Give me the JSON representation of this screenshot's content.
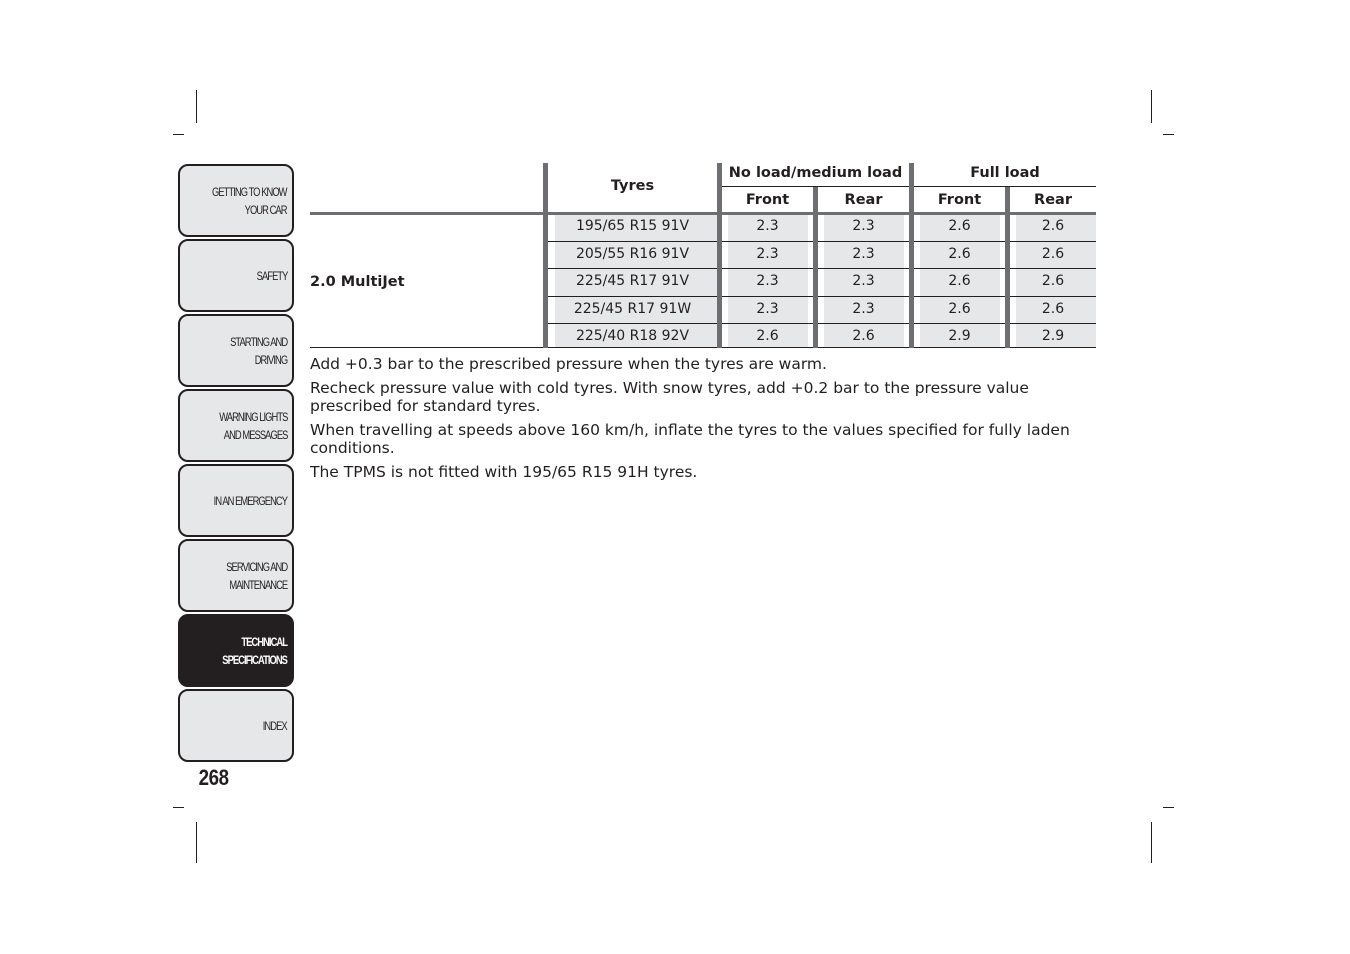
{
  "sidebar": {
    "tabs": [
      {
        "label": "GETTING TO KNOW\nYOUR CAR",
        "active": false
      },
      {
        "label": "SAFETY",
        "active": false
      },
      {
        "label": "STARTING AND\nDRIVING",
        "active": false
      },
      {
        "label": "WARNING LIGHTS\nAND MESSAGES",
        "active": false
      },
      {
        "label": "IN AN EMERGENCY",
        "active": false
      },
      {
        "label": "SERVICING AND\nMAINTENANCE",
        "active": false
      },
      {
        "label": "TECHNICAL\nSPECIFICATIONS",
        "active": true
      },
      {
        "label": "INDEX",
        "active": false
      }
    ],
    "page_number": "268"
  },
  "table": {
    "headers": {
      "tyres": "Tyres",
      "group_no_load": "No load/medium load",
      "group_full_load": "Full load",
      "front": "Front",
      "rear": "Rear"
    },
    "engine": "2.0 MultiJet",
    "rows": [
      {
        "tyre": "195/65 R15 91V",
        "nl_front": "2.3",
        "nl_rear": "2.3",
        "fl_front": "2.6",
        "fl_rear": "2.6"
      },
      {
        "tyre": "205/55 R16 91V",
        "nl_front": "2.3",
        "nl_rear": "2.3",
        "fl_front": "2.6",
        "fl_rear": "2.6"
      },
      {
        "tyre": "225/45 R17 91V",
        "nl_front": "2.3",
        "nl_rear": "2.3",
        "fl_front": "2.6",
        "fl_rear": "2.6"
      },
      {
        "tyre": "225/45 R17 91W",
        "nl_front": "2.3",
        "nl_rear": "2.3",
        "fl_front": "2.6",
        "fl_rear": "2.6"
      },
      {
        "tyre": "225/40 R18 92V",
        "nl_front": "2.6",
        "nl_rear": "2.6",
        "fl_front": "2.9",
        "fl_rear": "2.9"
      }
    ]
  },
  "notes": [
    "Add +0.3 bar to the prescribed pressure when the tyres are warm.",
    "Recheck pressure value with cold tyres. With snow tyres, add +0.2 bar to the pressure value prescribed for standard tyres.",
    "When travelling at speeds above 160 km/h, inflate the tyres to the values specified for fully laden conditions.",
    "The TPMS is not fitted with 195/65 R15 91H tyres."
  ]
}
